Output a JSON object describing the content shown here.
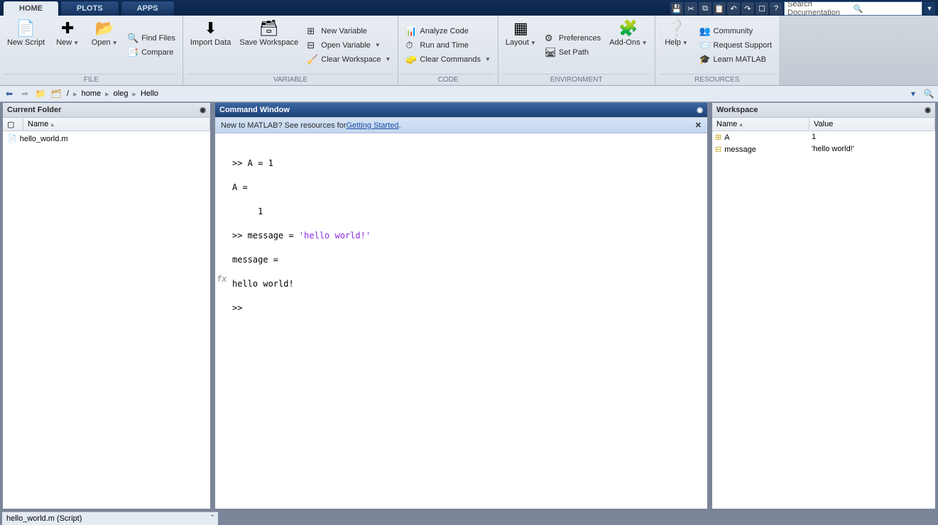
{
  "tabs": {
    "home": "HOME",
    "plots": "PLOTS",
    "apps": "APPS"
  },
  "search": {
    "placeholder": "Search Documentation"
  },
  "ribbon": {
    "file": {
      "newscript": "New\nScript",
      "new": "New",
      "open": "Open",
      "findfiles": "Find Files",
      "compare": "Compare",
      "label": "FILE"
    },
    "variable": {
      "import": "Import\nData",
      "save": "Save\nWorkspace",
      "newvar": "New Variable",
      "openvar": "Open Variable",
      "clearws": "Clear Workspace",
      "label": "VARIABLE"
    },
    "code": {
      "analyze": "Analyze Code",
      "runtime": "Run and Time",
      "clearcmd": "Clear Commands",
      "label": "CODE"
    },
    "env": {
      "layout": "Layout",
      "prefs": "Preferences",
      "setpath": "Set Path",
      "addons": "Add-Ons",
      "label": "ENVIRONMENT"
    },
    "res": {
      "help": "Help",
      "community": "Community",
      "support": "Request Support",
      "learn": "Learn MATLAB",
      "label": "RESOURCES"
    }
  },
  "breadcrumb": {
    "root": "/",
    "p1": "home",
    "p2": "oleg",
    "p3": "Hello"
  },
  "currentFolder": {
    "title": "Current Folder",
    "col": "Name",
    "files": [
      {
        "name": "hello_world.m"
      }
    ]
  },
  "cmdwin": {
    "title": "Command Window",
    "banner_pre": "New to MATLAB? See resources for ",
    "banner_link": "Getting Started",
    "lines": [
      ">> A = 1",
      "",
      "A =",
      "",
      "     1",
      "",
      ">> message = 'hello world!'",
      "",
      "message =",
      "",
      "hello world!",
      "",
      ">> "
    ]
  },
  "workspace": {
    "title": "Workspace",
    "col1": "Name",
    "col2": "Value",
    "vars": [
      {
        "name": "A",
        "value": "1"
      },
      {
        "name": "message",
        "value": "'hello world!'"
      }
    ]
  },
  "status": {
    "file": "hello_world.m  (Script)"
  }
}
